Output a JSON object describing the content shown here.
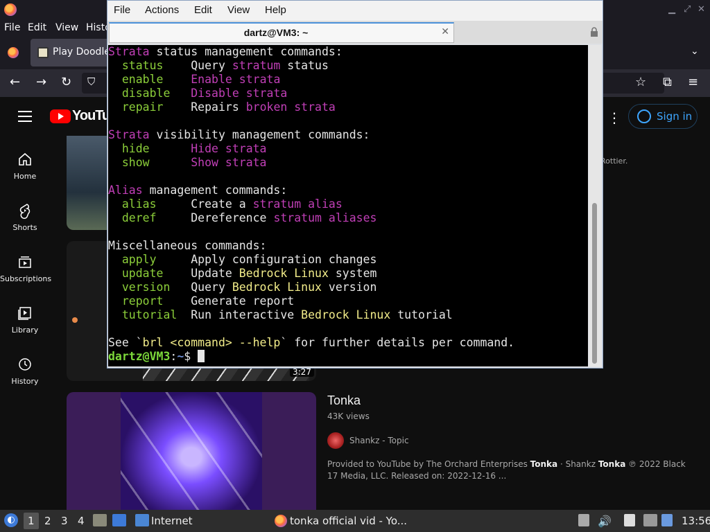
{
  "firefox": {
    "menu": [
      "File",
      "Edit",
      "View",
      "Histo"
    ],
    "tab_title": "Play Doodle",
    "window_controls": [
      "minimize-icon",
      "maximize-icon",
      "close-icon"
    ]
  },
  "youtube": {
    "logo_text": "YouTube",
    "sign_in": "Sign in",
    "nav": [
      {
        "label": "Home",
        "icon": "home-icon"
      },
      {
        "label": "Shorts",
        "icon": "shorts-icon"
      },
      {
        "label": "Subscriptions",
        "icon": "subscriptions-icon"
      },
      {
        "label": "Library",
        "icon": "library-icon"
      },
      {
        "label": "History",
        "icon": "history-icon"
      }
    ],
    "partial_text": "Rottier.",
    "duration": "3:27",
    "video": {
      "title": "Tonka",
      "views": "43K views",
      "channel": "Shankz - Topic",
      "desc_1": "Provided to YouTube by The Orchard Enterprises ",
      "desc_b1": "Tonka",
      "desc_2": " · Shankz ",
      "desc_b2": "Tonka",
      "desc_3": " ℗ 2022 Black 17 Media, LLC. Released on: 2022-12-16 ..."
    }
  },
  "terminal": {
    "menu": [
      "File",
      "Actions",
      "Edit",
      "View",
      "Help"
    ],
    "tab_title": "dartz@VM3: ~",
    "lines": [
      [
        {
          "t": "Strata",
          "c": "mag"
        },
        {
          "t": " status management commands:",
          "c": "wht"
        }
      ],
      [
        {
          "t": "  status",
          "c": "grn"
        },
        {
          "t": "    Query ",
          "c": "wht"
        },
        {
          "t": "stratum",
          "c": "mag"
        },
        {
          "t": " status",
          "c": "wht"
        }
      ],
      [
        {
          "t": "  enable",
          "c": "grn"
        },
        {
          "t": "    ",
          "c": "wht"
        },
        {
          "t": "Enable strata",
          "c": "mag"
        }
      ],
      [
        {
          "t": "  disable",
          "c": "grn"
        },
        {
          "t": "   ",
          "c": "wht"
        },
        {
          "t": "Disable strata",
          "c": "mag"
        }
      ],
      [
        {
          "t": "  repair",
          "c": "grn"
        },
        {
          "t": "    Repairs ",
          "c": "wht"
        },
        {
          "t": "broken strata",
          "c": "mag"
        }
      ],
      [],
      [
        {
          "t": "Strata",
          "c": "mag"
        },
        {
          "t": " visibility management commands:",
          "c": "wht"
        }
      ],
      [
        {
          "t": "  hide",
          "c": "grn"
        },
        {
          "t": "      ",
          "c": "wht"
        },
        {
          "t": "Hide strata",
          "c": "mag"
        }
      ],
      [
        {
          "t": "  show",
          "c": "grn"
        },
        {
          "t": "      ",
          "c": "wht"
        },
        {
          "t": "Show strata",
          "c": "mag"
        }
      ],
      [],
      [
        {
          "t": "Alias",
          "c": "mag"
        },
        {
          "t": " management commands:",
          "c": "wht"
        }
      ],
      [
        {
          "t": "  alias",
          "c": "grn"
        },
        {
          "t": "     Create a ",
          "c": "wht"
        },
        {
          "t": "stratum alias",
          "c": "mag"
        }
      ],
      [
        {
          "t": "  deref",
          "c": "grn"
        },
        {
          "t": "     Dereference ",
          "c": "wht"
        },
        {
          "t": "stratum aliases",
          "c": "mag"
        }
      ],
      [],
      [
        {
          "t": "Miscellaneous commands:",
          "c": "wht"
        }
      ],
      [
        {
          "t": "  apply",
          "c": "grn"
        },
        {
          "t": "     Apply configuration changes",
          "c": "wht"
        }
      ],
      [
        {
          "t": "  update",
          "c": "grn"
        },
        {
          "t": "    Update ",
          "c": "wht"
        },
        {
          "t": "Bedrock Linux",
          "c": "yel"
        },
        {
          "t": " system",
          "c": "wht"
        }
      ],
      [
        {
          "t": "  version",
          "c": "grn"
        },
        {
          "t": "   Query ",
          "c": "wht"
        },
        {
          "t": "Bedrock Linux",
          "c": "yel"
        },
        {
          "t": " version",
          "c": "wht"
        }
      ],
      [
        {
          "t": "  report",
          "c": "grn"
        },
        {
          "t": "    Generate report",
          "c": "wht"
        }
      ],
      [
        {
          "t": "  tutorial",
          "c": "grn"
        },
        {
          "t": "  Run interactive ",
          "c": "wht"
        },
        {
          "t": "Bedrock Linux",
          "c": "yel"
        },
        {
          "t": " tutorial",
          "c": "wht"
        }
      ],
      [],
      [
        {
          "t": "See `",
          "c": "wht"
        },
        {
          "t": "brl <command> --help",
          "c": "yel"
        },
        {
          "t": "` for further details per command.",
          "c": "wht"
        }
      ]
    ],
    "prompt_user": "dartz@VM3",
    "prompt_sep": ":",
    "prompt_path": "~",
    "prompt_symbol": "$ "
  },
  "taskbar": {
    "workspaces": [
      "1",
      "2",
      "3",
      "4"
    ],
    "internet_label": "Internet",
    "firefox_task": "tonka official vid - Yo...",
    "clock": "13:56"
  }
}
